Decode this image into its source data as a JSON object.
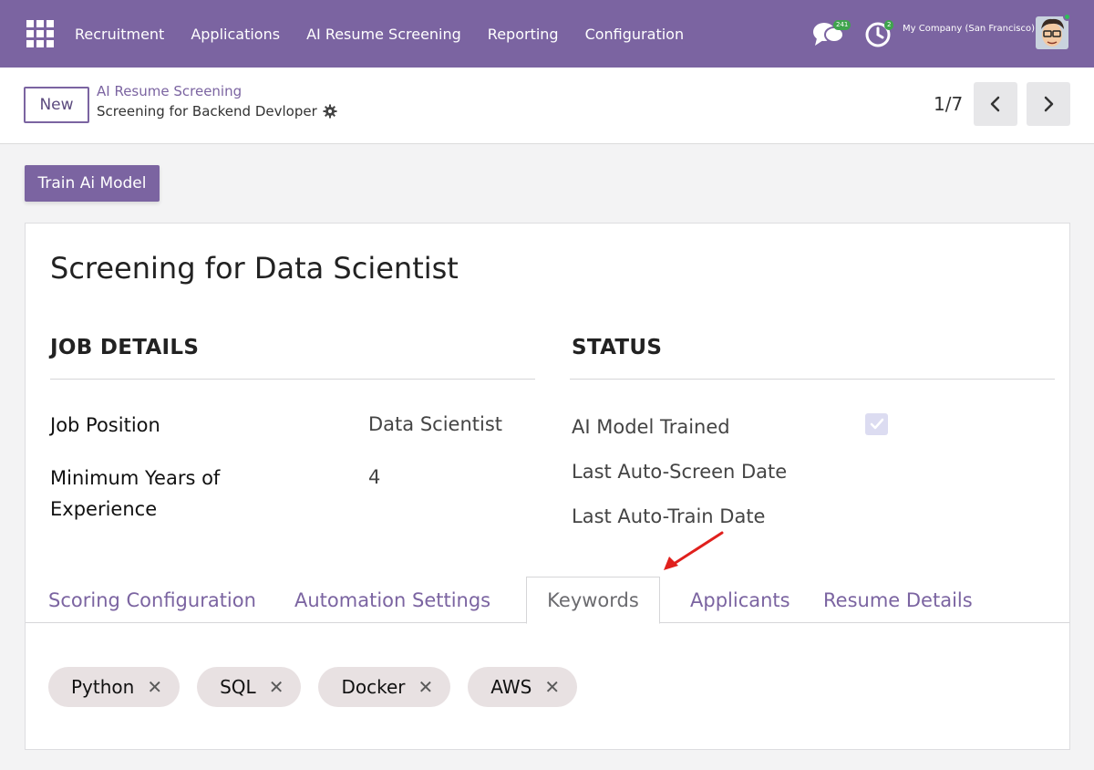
{
  "navbar": {
    "menu": [
      "Recruitment",
      "Applications",
      "AI Resume Screening",
      "Reporting",
      "Configuration"
    ],
    "chat_badge": "241",
    "activity_badge": "2",
    "company": "My Company (San Francisco)"
  },
  "control_panel": {
    "new_label": "New",
    "breadcrumb_parent": "AI Resume Screening",
    "breadcrumb_current": "Screening for Backend Devloper",
    "pager": "1/7"
  },
  "actions": {
    "train_label": "Train Ai Model"
  },
  "record": {
    "title": "Screening for Data Scientist",
    "job_details": {
      "heading": "JOB DETAILS",
      "job_position_label": "Job Position",
      "job_position_value": "Data Scientist",
      "min_years_label": "Minimum Years of Experience",
      "min_years_value": "4"
    },
    "status": {
      "heading": "STATUS",
      "ai_model_trained_label": "AI Model Trained",
      "ai_model_trained_checked": true,
      "last_auto_screen_label": "Last Auto-Screen Date",
      "last_auto_train_label": "Last Auto-Train Date"
    }
  },
  "tabs": [
    "Scoring Configuration",
    "Automation Settings",
    "Keywords",
    "Applicants",
    "Resume Details"
  ],
  "active_tab": "Keywords",
  "keywords": [
    "Python",
    "SQL",
    "Docker",
    "AWS"
  ],
  "colors": {
    "brand": "#7b64a1",
    "annotation_arrow": "#e0201d",
    "tag_bg": "#e8e1e2"
  }
}
